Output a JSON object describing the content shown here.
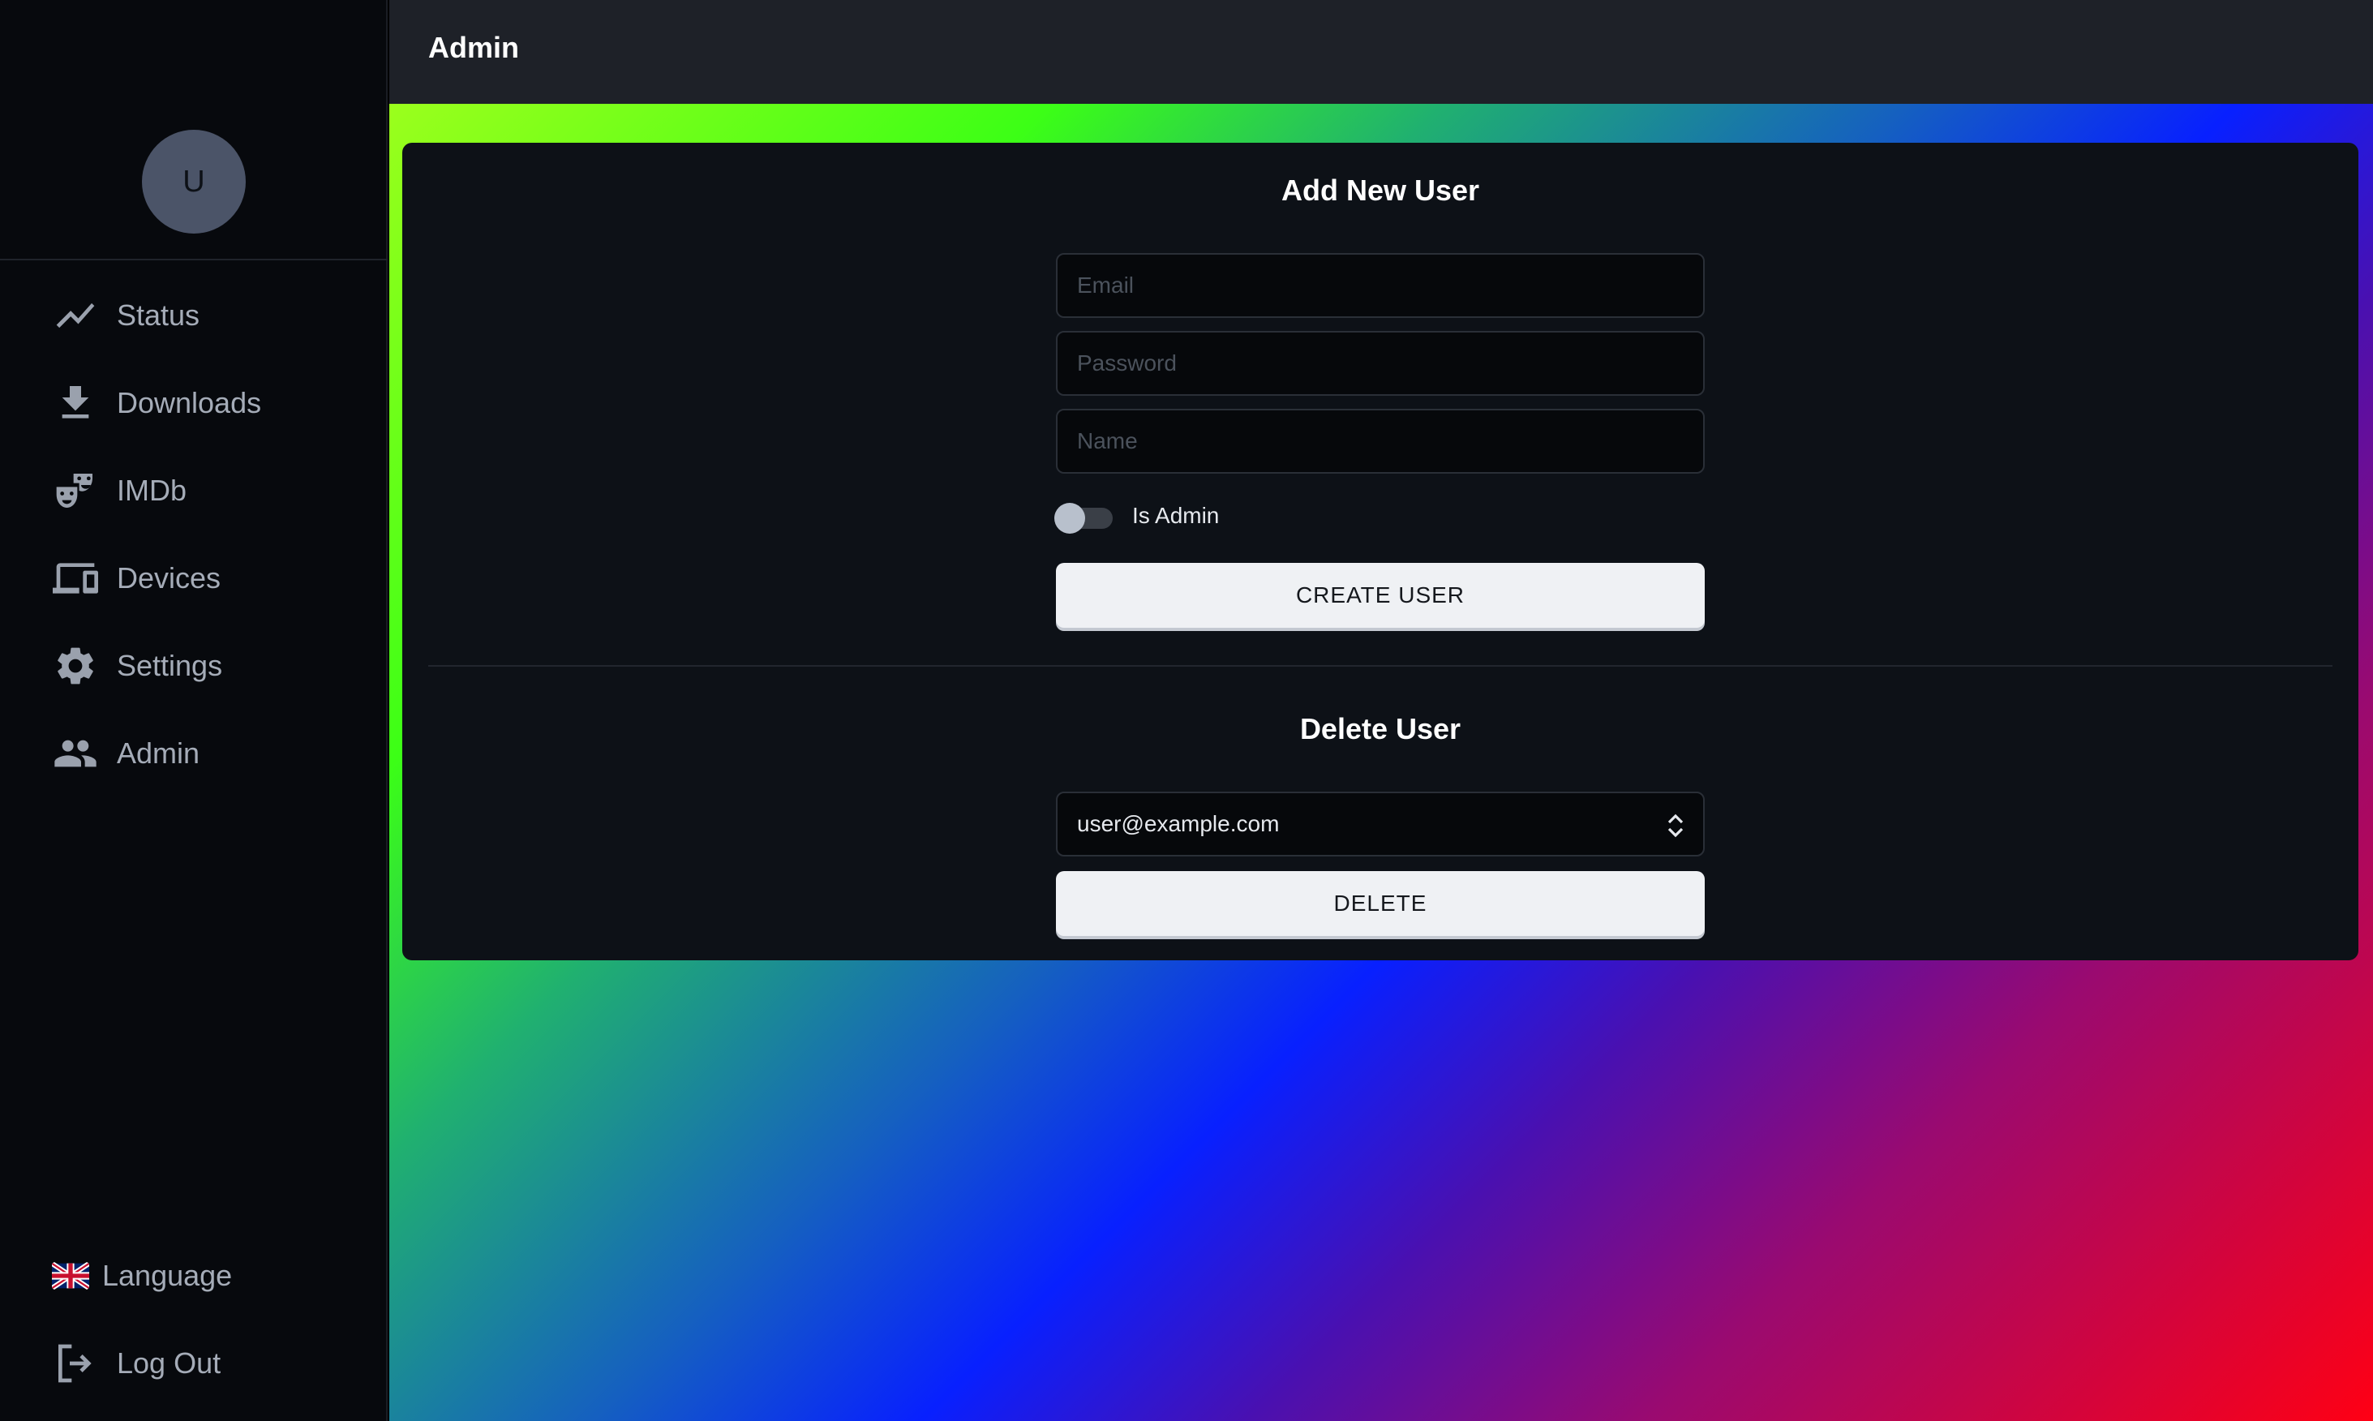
{
  "app": {
    "avatar_initial": "U",
    "page_title": "Admin"
  },
  "sidebar": {
    "items": [
      {
        "label": "Status",
        "icon": "trend-line-icon"
      },
      {
        "label": "Downloads",
        "icon": "download-icon"
      },
      {
        "label": "IMDb",
        "icon": "theater-masks-icon"
      },
      {
        "label": "Devices",
        "icon": "devices-icon"
      },
      {
        "label": "Settings",
        "icon": "gear-icon"
      },
      {
        "label": "Admin",
        "icon": "users-icon"
      }
    ],
    "language_label": "Language",
    "language_icon": "uk-flag-icon",
    "logout_label": "Log Out",
    "logout_icon": "logout-icon"
  },
  "add_user": {
    "title": "Add New User",
    "email_placeholder": "Email",
    "password_placeholder": "Password",
    "name_placeholder": "Name",
    "is_admin_label": "Is Admin",
    "is_admin_checked": false,
    "create_button": "CREATE USER"
  },
  "delete_user": {
    "title": "Delete User",
    "selected_user": "user@example.com",
    "delete_button": "DELETE"
  },
  "colors": {
    "sidebar_bg": "#07090d",
    "topbar_bg": "#1e2128",
    "card_bg": "#0d1117",
    "button_bg": "#eff1f4"
  }
}
